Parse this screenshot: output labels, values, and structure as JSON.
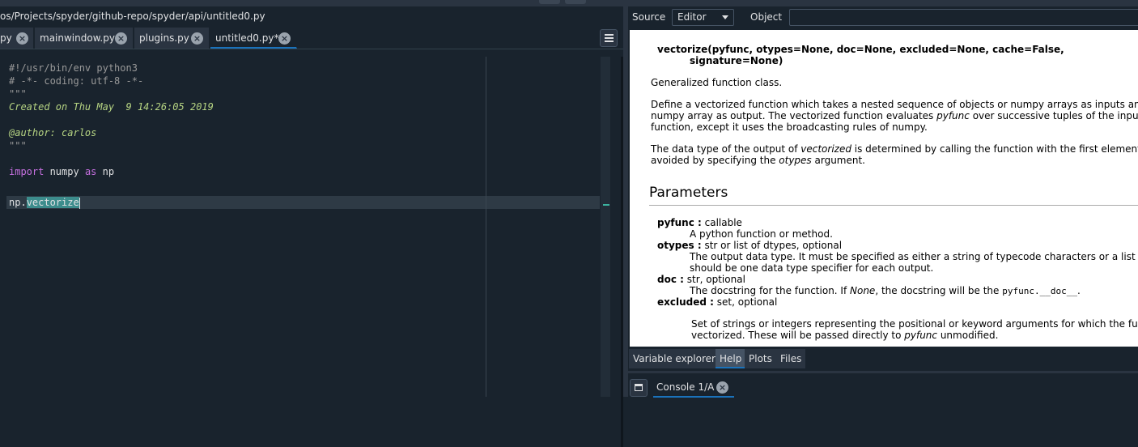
{
  "editor": {
    "path": "os/Projects/spyder/github-repo/spyder/api/untitled0.py",
    "tabs": [
      {
        "label": "py"
      },
      {
        "label": "mainwindow.py"
      },
      {
        "label": "plugins.py"
      },
      {
        "label": "untitled0.py*"
      }
    ],
    "code": {
      "shebang": "#!/usr/bin/env python3",
      "coding": "# -*- coding: utf-8 -*-",
      "doc_open": "\"\"\"",
      "created": "Created on Thu May  9 14:26:05 2019",
      "author": "@author: carlos",
      "doc_close": "\"\"\"",
      "import_kw": "import",
      "import_mod": " numpy ",
      "as_kw": "as",
      "import_alias": " np",
      "call_obj": "np.",
      "call_attr": "vectorize"
    }
  },
  "help": {
    "source_label": "Source",
    "source_value": "Editor",
    "object_label": "Object",
    "signature_line1": "vectorize(pyfunc, otypes=None, doc=None, excluded=None, cache=False,",
    "signature_line2": "signature=None)",
    "summary": "Generalized function class.",
    "desc1_line1": "Define a vectorized function which takes a nested sequence of objects or numpy arrays as inputs and re",
    "desc1_line2_a": "numpy array as output. The vectorized function evaluates ",
    "desc1_line2_em": "pyfunc",
    "desc1_line2_b": " over successive tuples of the input arr",
    "desc1_line3": "function, except it uses the broadcasting rules of numpy.",
    "desc2_line1_a": "The data type of the output of ",
    "desc2_line1_em": "vectorized",
    "desc2_line1_b": " is determined by calling the function with the first element o",
    "desc2_line2_a": "avoided by specifying the ",
    "desc2_line2_em": "otypes",
    "desc2_line2_b": " argument.",
    "params_title": "Parameters",
    "p1_name": "pyfunc :",
    "p1_type": " callable",
    "p1_desc": "A python function or method.",
    "p2_name": "otypes :",
    "p2_type": " str or list of dtypes, optional",
    "p2_desc1": "The output data type. It must be specified as either a string of typecode characters or a list of d",
    "p2_desc2": "should be one data type specifier for each output.",
    "p3_name": "doc :",
    "p3_type": " str, optional",
    "p3_desc_a": "The docstring for the function. If ",
    "p3_desc_em": "None",
    "p3_desc_b": ", the docstring will be the ",
    "p3_desc_code": "pyfunc.__doc__",
    "p3_desc_c": ".",
    "p4_name": "excluded :",
    "p4_type": " set, optional",
    "p4_desc1": "Set of strings or integers representing the positional or keyword arguments for which the func",
    "p4_desc2_a": "vectorized. These will be passed directly to ",
    "p4_desc2_em": "pyfunc",
    "p4_desc2_b": " unmodified."
  },
  "pane_tabs": [
    {
      "label": "Variable explorer"
    },
    {
      "label": "Help"
    },
    {
      "label": "Plots"
    },
    {
      "label": "Files"
    }
  ],
  "console": {
    "tab_label": "Console 1/A"
  },
  "icons": {
    "close": "×"
  },
  "colors": {
    "background": "#19232d",
    "accent": "#1a72bb",
    "selection": "#3c8c8c",
    "docstring": "#b5d382",
    "keyword": "#c670e0"
  }
}
